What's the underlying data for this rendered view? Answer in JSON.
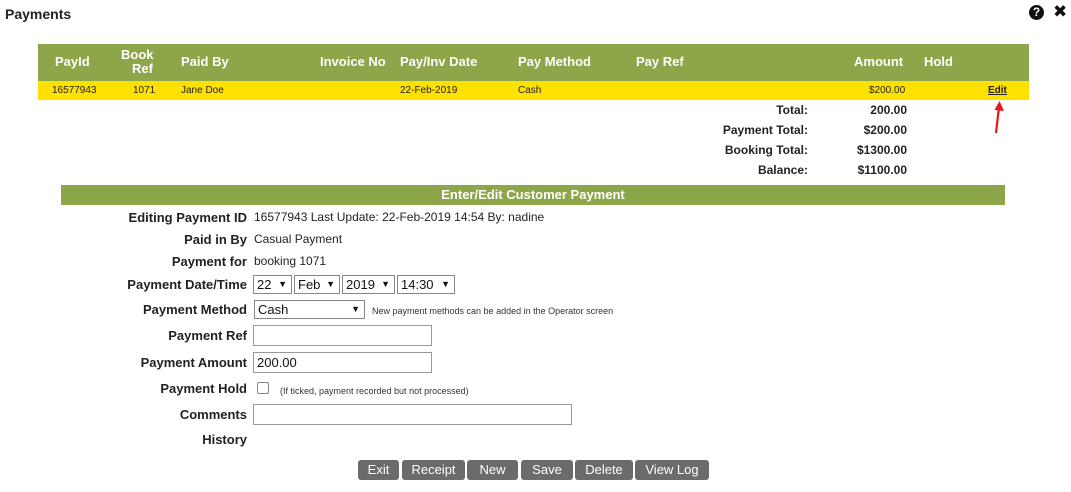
{
  "window": {
    "title": "Payments",
    "help_icon": "?",
    "close_icon": "✖"
  },
  "grid": {
    "columns": [
      "PayId",
      "Book Ref",
      "Paid By",
      "Invoice No",
      "Pay/Inv Date",
      "Pay Method",
      "Pay Ref",
      "Amount",
      "Hold"
    ],
    "columns_book_line1": "Book",
    "columns_book_line2": "Ref",
    "row": {
      "pay_id": "16577943",
      "book_ref": "1071",
      "paid_by": "Jane Doe",
      "invoice_no": "",
      "pay_date": "22-Feb-2019",
      "pay_method": "Cash",
      "pay_ref": "",
      "amount": "$200.00",
      "hold": "",
      "edit_label": "Edit"
    },
    "highlight_color": "#ffe100"
  },
  "totals": {
    "total_label": "Total:",
    "total_value": "200.00",
    "payment_total_label": "Payment Total:",
    "payment_total_value": "$200.00",
    "booking_total_label": "Booking Total:",
    "booking_total_value": "$1300.00",
    "balance_label": "Balance:",
    "balance_value": "$1100.00"
  },
  "form": {
    "section_title": "Enter/Edit Customer Payment",
    "editing_id_label": "Editing Payment ID",
    "editing_id_value": "16577943 Last Update: 22-Feb-2019 14:54 By: nadine",
    "paid_in_by_label": "Paid in By",
    "paid_in_by_value": "Casual Payment",
    "payment_for_label": "Payment for",
    "payment_for_value": "booking 1071",
    "datetime_label": "Payment Date/Time",
    "day": "22",
    "month": "Feb",
    "year": "2019",
    "time": "14:30",
    "method_label": "Payment Method",
    "method_value": "Cash",
    "method_note": "New payment methods can be added in the Operator screen",
    "ref_label": "Payment Ref",
    "ref_value": "",
    "amount_label": "Payment Amount",
    "amount_value": "200.00",
    "hold_label": "Payment Hold",
    "hold_checked": false,
    "hold_note": "(If ticked, payment recorded but not processed)",
    "comments_label": "Comments",
    "comments_value": "",
    "history_label": "History"
  },
  "buttons": {
    "exit": "Exit",
    "receipt": "Receipt",
    "new": "New",
    "save": "Save",
    "delete": "Delete",
    "view_log": "View Log"
  },
  "colors": {
    "header_green": "#8da64a",
    "row_yellow": "#ffe100",
    "button_gray": "#6b6b6b",
    "arrow_red": "#e8141e"
  }
}
